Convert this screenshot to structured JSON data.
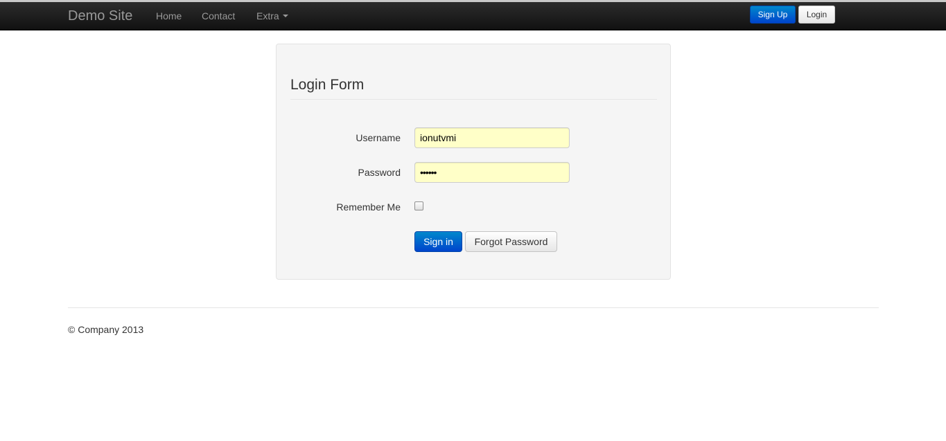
{
  "navbar": {
    "brand": "Demo Site",
    "links": [
      {
        "label": "Home"
      },
      {
        "label": "Contact"
      },
      {
        "label": "Extra"
      }
    ],
    "extra_caret_icon": "caret-down-icon",
    "signup_label": "Sign Up",
    "login_label": "Login"
  },
  "form": {
    "title": "Login Form",
    "username_label": "Username",
    "username_value": "ionutvmi",
    "password_label": "Password",
    "password_value": "••••••",
    "remember_label": "Remember Me",
    "remember_checked": false,
    "signin_label": "Sign in",
    "forgot_label": "Forgot Password"
  },
  "footer": {
    "text": "© Company 2013"
  },
  "colors": {
    "navbar_bg": "#1b1b1b",
    "primary": "#0055cc",
    "autofill_bg": "#ffffc8",
    "panel_bg": "#f5f5f5"
  }
}
